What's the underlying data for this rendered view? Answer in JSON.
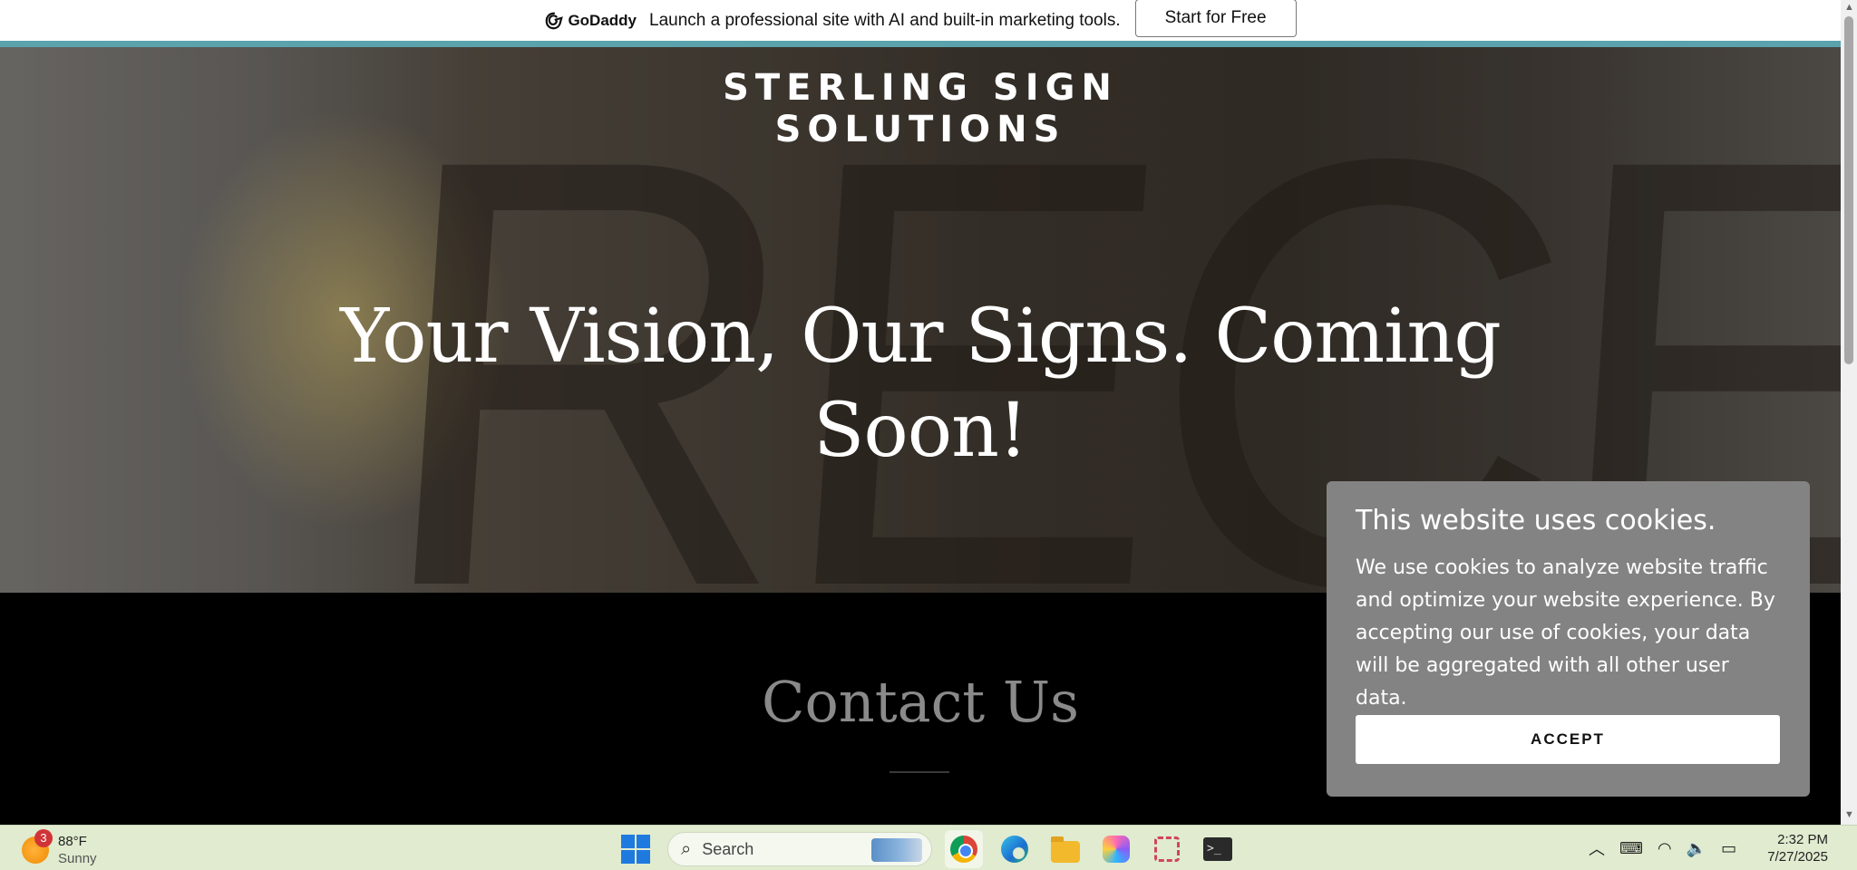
{
  "promo": {
    "brand": "GoDaddy",
    "text": "Launch a professional site with AI and built-in marketing tools.",
    "button": "Start for Free"
  },
  "hero": {
    "brand_line1": "STERLING SIGN",
    "brand_line2": "SOLUTIONS",
    "headline_line1": "Your Vision, Our Signs. Coming",
    "headline_line2": "Soon!"
  },
  "contact": {
    "title": "Contact Us"
  },
  "cookie": {
    "title": "This website uses cookies.",
    "body": "We use cookies to analyze website traffic and optimize your website experience. By accepting our use of cookies, your data will be aggregated with all other user data.",
    "accept": "ACCEPT"
  },
  "taskbar": {
    "weather_badge": "3",
    "temperature": "88°F",
    "condition": "Sunny",
    "search_placeholder": "Search",
    "time": "2:32 PM",
    "date": "7/27/2025"
  },
  "colors": {
    "accent_teal": "#5aa3ad",
    "cookie_bg": "#838383",
    "taskbar_bg": "#e0ebcf"
  }
}
